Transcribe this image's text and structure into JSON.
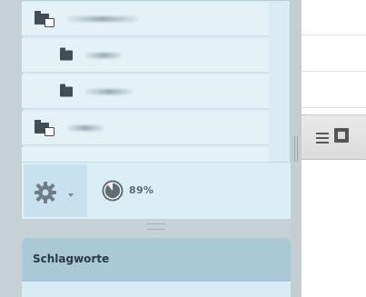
{
  "tree": {
    "rows": [
      {
        "level": 0,
        "icon": "folder-stack-icon",
        "label": ""
      },
      {
        "level": 1,
        "icon": "folder-icon",
        "label": ""
      },
      {
        "level": 1,
        "icon": "folder-icon",
        "label": ""
      },
      {
        "level": 0,
        "icon": "folder-stack-icon",
        "label": ""
      }
    ]
  },
  "toolbar": {
    "gear_icon": "gear-icon",
    "progress_percent": 89,
    "progress_label": "89%"
  },
  "tags_panel": {
    "title": "Schlagworte"
  },
  "right_toolbar": {
    "icons": [
      "list-view-icon",
      "grid-view-icon"
    ]
  },
  "colors": {
    "panel_bg": "#d9ecf5",
    "header_bg": "#a9c9d7",
    "icon_dark": "#3f4d56"
  }
}
